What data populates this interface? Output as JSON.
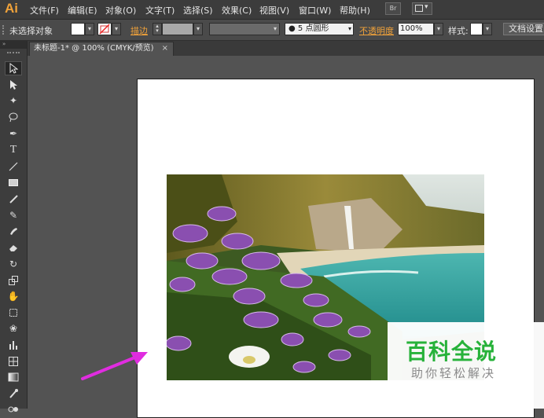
{
  "app": {
    "logo": "Ai"
  },
  "menu": [
    "文件(F)",
    "编辑(E)",
    "对象(O)",
    "文字(T)",
    "选择(S)",
    "效果(C)",
    "视图(V)",
    "窗口(W)",
    "帮助(H)"
  ],
  "menubar_buttons": {
    "bridge": "Br",
    "arrange": "▾"
  },
  "control": {
    "no_selection": "未选择对象",
    "stroke_label": "描边",
    "brush_value": "5 点圆形",
    "opacity_label": "不透明度",
    "opacity_value": "100%",
    "style_label": "样式:",
    "doc_setup": "文档设置"
  },
  "document_tab": {
    "title": "未标题-1* @ 100% (CMYK/预览)",
    "close": "×"
  },
  "tools": [
    "selection-tool-icon",
    "direct-selection-tool-icon",
    "magic-wand-tool-icon",
    "lasso-tool-icon",
    "pen-tool-icon",
    "type-tool-icon",
    "line-tool-icon",
    "rectangle-tool-icon",
    "paintbrush-tool-icon",
    "pencil-tool-icon",
    "blob-brush-tool-icon",
    "eraser-tool-icon",
    "rotate-tool-icon",
    "scale-tool-icon",
    "warp-tool-icon",
    "free-transform-tool-icon",
    "symbol-sprayer-tool-icon",
    "graph-tool-icon",
    "mesh-tool-icon",
    "gradient-tool-icon",
    "eyedropper-tool-icon",
    "blend-tool-icon"
  ],
  "watermark": {
    "main": "百科全说",
    "sub": "助你轻松解决"
  },
  "colors": {
    "accent_orange": "#f0a23a",
    "watermark_green": "#27b23a",
    "arrow_magenta": "#e02ce0"
  }
}
